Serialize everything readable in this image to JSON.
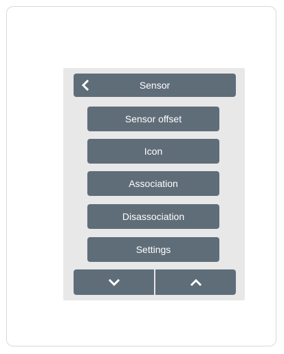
{
  "header": {
    "title": "Sensor",
    "back_icon": "chevron-left-icon"
  },
  "menu": {
    "items": [
      {
        "label": "Sensor offset"
      },
      {
        "label": "Icon"
      },
      {
        "label": "Association"
      },
      {
        "label": "Disassociation"
      },
      {
        "label": "Settings"
      }
    ]
  },
  "nav": {
    "down_icon": "chevron-down-icon",
    "up_icon": "chevron-up-icon"
  },
  "colors": {
    "button": "#5f6d79",
    "screen_bg": "#e8e8e8",
    "text": "#ffffff"
  }
}
